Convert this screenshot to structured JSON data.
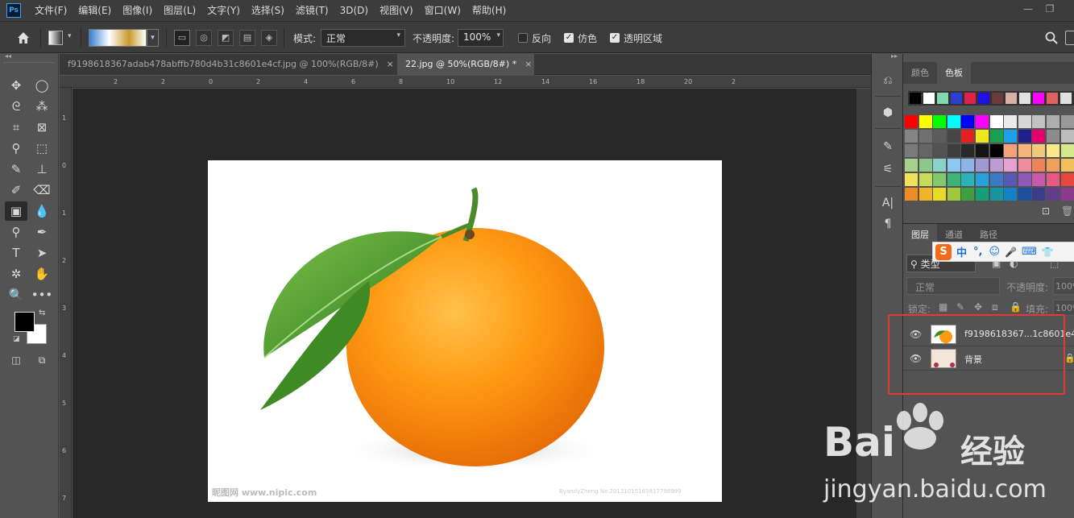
{
  "menu": {
    "logo": "Ps",
    "items": [
      "文件(F)",
      "编辑(E)",
      "图像(I)",
      "图层(L)",
      "文字(Y)",
      "选择(S)",
      "滤镜(T)",
      "3D(D)",
      "视图(V)",
      "窗口(W)",
      "帮助(H)"
    ]
  },
  "options": {
    "mode_label": "模式:",
    "mode_value": "正常",
    "opacity_label": "不透明度:",
    "opacity_value": "100%",
    "reverse_label": "反向",
    "dither_label": "仿色",
    "transparency_label": "透明区域",
    "reverse_checked": false,
    "dither_checked": true,
    "transparency_checked": true
  },
  "tabs": [
    {
      "label": "f9198618367adab478abffb780d4b31c8601e4cf.jpg @ 100%(RGB/8#)",
      "close": "×"
    },
    {
      "label": "22.jpg @ 50%(RGB/8#) *",
      "close": "×"
    }
  ],
  "ruler": {
    "top": [
      "2",
      "2",
      "0",
      "2",
      "4",
      "6",
      "8",
      "10",
      "12",
      "14",
      "16",
      "18",
      "20",
      "2"
    ],
    "left": [
      "1",
      "0",
      "1",
      "2",
      "3",
      "4",
      "5",
      "6",
      "7"
    ]
  },
  "document_watermarks": {
    "left": "昵图网 www.nipic.com",
    "right": "ByandyZheng No.20131015163817798999"
  },
  "swatches_panel": {
    "tab_color": "颜色",
    "tab_swatches": "色板",
    "recent": [
      "#000000",
      "#ffffff",
      "#7fd8b0",
      "#2a3fd0",
      "#e0204a",
      "#1f10e6",
      "#6a3a3a",
      "#d8b0a8",
      "#e0e0e0",
      "#ff00ff",
      "#e06060",
      "#e0e0e0"
    ],
    "grid": [
      [
        "#ff0000",
        "#ffff00",
        "#00ff00",
        "#00ffff",
        "#0000ff",
        "#ff00ff",
        "#ffffff",
        "#eaeaea",
        "#d6d6d6",
        "#c2c2c2",
        "#adadad",
        "#999999"
      ],
      [
        "#858585",
        "#707070",
        "#5c5c5c",
        "#474747",
        "#e61e1e",
        "#f0e61e",
        "#16a050",
        "#1ea0e6",
        "#20208c",
        "#e6006e",
        "#8c8c8c",
        "#bdbdbd"
      ],
      [
        "#7a7a7a",
        "#666666",
        "#525252",
        "#3d3d3d",
        "#292929",
        "#141414",
        "#000000",
        "#f4a07a",
        "#f4b47a",
        "#f4c87a",
        "#fbe78a",
        "#d6e88c"
      ],
      [
        "#a8d28c",
        "#8cc88c",
        "#8cd2c8",
        "#8cc8f0",
        "#8cb4e6",
        "#a09ad2",
        "#c09ad2",
        "#e6a0d2",
        "#f08ca0",
        "#f0825a",
        "#f0a05a",
        "#f0c05a"
      ],
      [
        "#f0e05a",
        "#c8dc5a",
        "#82c86e",
        "#3cb478",
        "#28b4b4",
        "#28a0dc",
        "#3c78c8",
        "#5a5ab4",
        "#8c5ab4",
        "#c85aaa",
        "#e65a82",
        "#e6463c"
      ],
      [
        "#f08c28",
        "#f0b428",
        "#e6dc28",
        "#a0c83c",
        "#3ca03c",
        "#14a078",
        "#1496a0",
        "#1482c8",
        "#1e50a0",
        "#3c3c8c",
        "#643c8c",
        "#8c3c8c"
      ]
    ]
  },
  "layers_panel": {
    "tab_layers": "图层",
    "tab_channels": "通道",
    "tab_paths": "路径",
    "filter_label": "类型",
    "blend_value": "正常",
    "opacity_label": "不透明度:",
    "opacity_value": "100%",
    "lock_label": "锁定:",
    "fill_label": "填充:",
    "fill_value": "100%",
    "layers": [
      {
        "name": "f9198618367...1c8601e4cf",
        "eye": "👁"
      },
      {
        "name": "背景",
        "eye": "👁"
      }
    ]
  },
  "ime": {
    "logo": "S",
    "lang": "中",
    "punct": "°,",
    "emoji": "☺",
    "mic": "🎤",
    "kb": "⌨",
    "more": "👕"
  },
  "watermark": {
    "brand": "Bai",
    "brand2": "经验",
    "url": "jingyan.baidu.com"
  },
  "colors": {
    "fg": "#000000",
    "bg": "#ffffff",
    "highlight": "#e03a3a"
  }
}
